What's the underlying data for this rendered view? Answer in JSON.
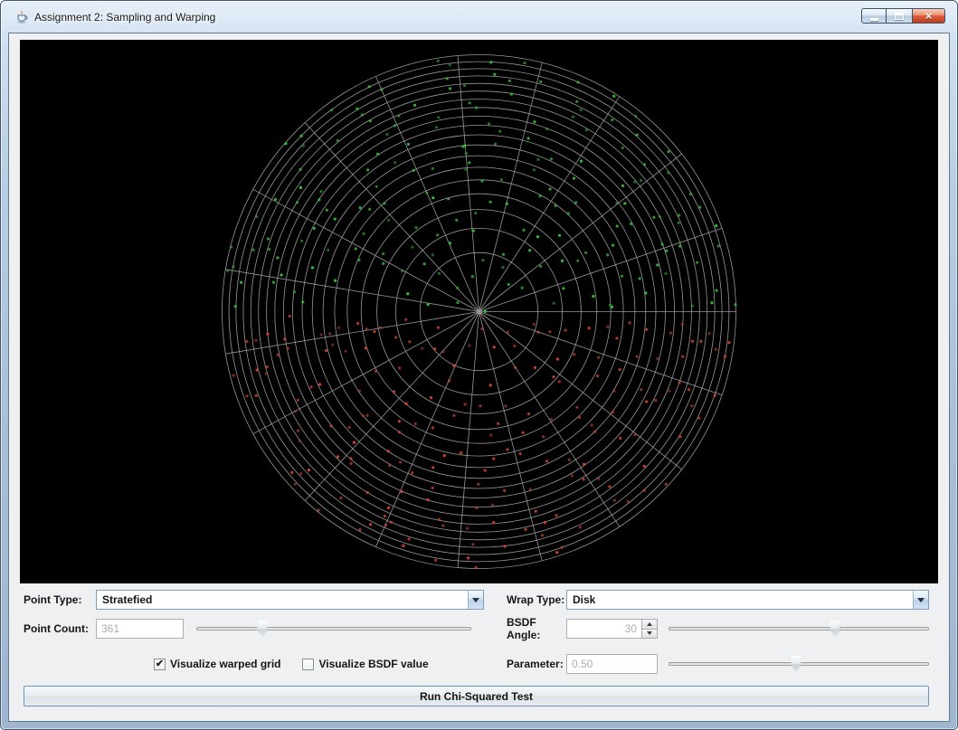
{
  "window": {
    "title": "Assignment 2: Sampling and Warping"
  },
  "icons": {
    "close": "×",
    "check": "✔"
  },
  "visualization": {
    "type": "stratified-samples-on-disk",
    "background": "#000000",
    "grid_color": "#b2b2b2",
    "rings": 19,
    "spokes": 19,
    "point_count": 361,
    "upper_half_point_color": "#33c133",
    "lower_half_point_color": "#d2452e"
  },
  "controls": {
    "point_type": {
      "label": "Point Type:",
      "value": "Stratefied"
    },
    "wrap_type": {
      "label": "Wrap Type:",
      "value": "Disk"
    },
    "point_count": {
      "label": "Point Count:",
      "value": "361",
      "slider_fraction": 0.24
    },
    "bsdf_angle": {
      "label": "BSDF Angle:",
      "value": "30",
      "slider_fraction": 0.64
    },
    "parameter": {
      "label": "Parameter:",
      "value": "0.50",
      "slider_fraction": 0.49
    },
    "checkboxes": {
      "warped_grid": {
        "label": "Visualize warped grid",
        "checked": true
      },
      "bsdf_value": {
        "label": "Visualize BSDF value",
        "checked": false
      }
    },
    "run_button": {
      "label": "Run Chi-Squared Test"
    }
  }
}
